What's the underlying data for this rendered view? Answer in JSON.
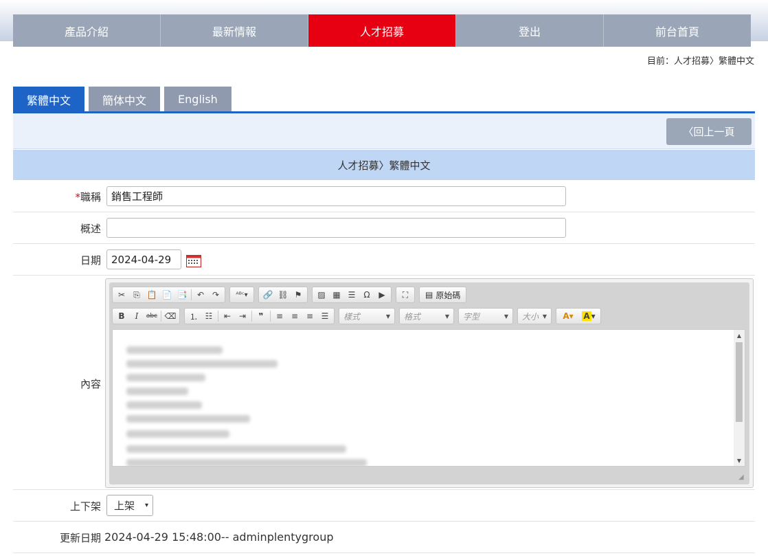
{
  "nav": {
    "items": [
      {
        "label": "產品介紹"
      },
      {
        "label": "最新情報"
      },
      {
        "label": "人才招募"
      },
      {
        "label": "登出"
      },
      {
        "label": "前台首頁"
      }
    ],
    "active_color": "#e60012"
  },
  "breadcrumb": "目前：人才招募〉繁體中文",
  "language_tabs": [
    {
      "label": "繁體中文"
    },
    {
      "label": "簡体中文"
    },
    {
      "label": "English"
    }
  ],
  "back_button": "〈回上一頁",
  "section_title": "人才招募〉繁體中文",
  "form": {
    "title": {
      "required_mark": "*",
      "label": "職稱",
      "value": "銷售工程師"
    },
    "summary": {
      "label": "概述",
      "value": ""
    },
    "date": {
      "label": "日期",
      "value": "2024-04-29"
    },
    "content": {
      "label": "內容"
    },
    "status": {
      "label": "上下架",
      "selected": "上架"
    },
    "updated": {
      "label": "更新日期",
      "value": "2024-04-29 15:48:00-- adminplentygroup"
    }
  },
  "editor": {
    "source_button": "原始碼",
    "combos": {
      "style": "樣式",
      "format": "格式",
      "font": "字型",
      "size": "大小"
    },
    "content_lines": "blurred"
  },
  "colors": {
    "tab_active": "#1e63c6",
    "tab_inactive": "#8f9aae",
    "nav_bg": "#9aa6b8"
  }
}
